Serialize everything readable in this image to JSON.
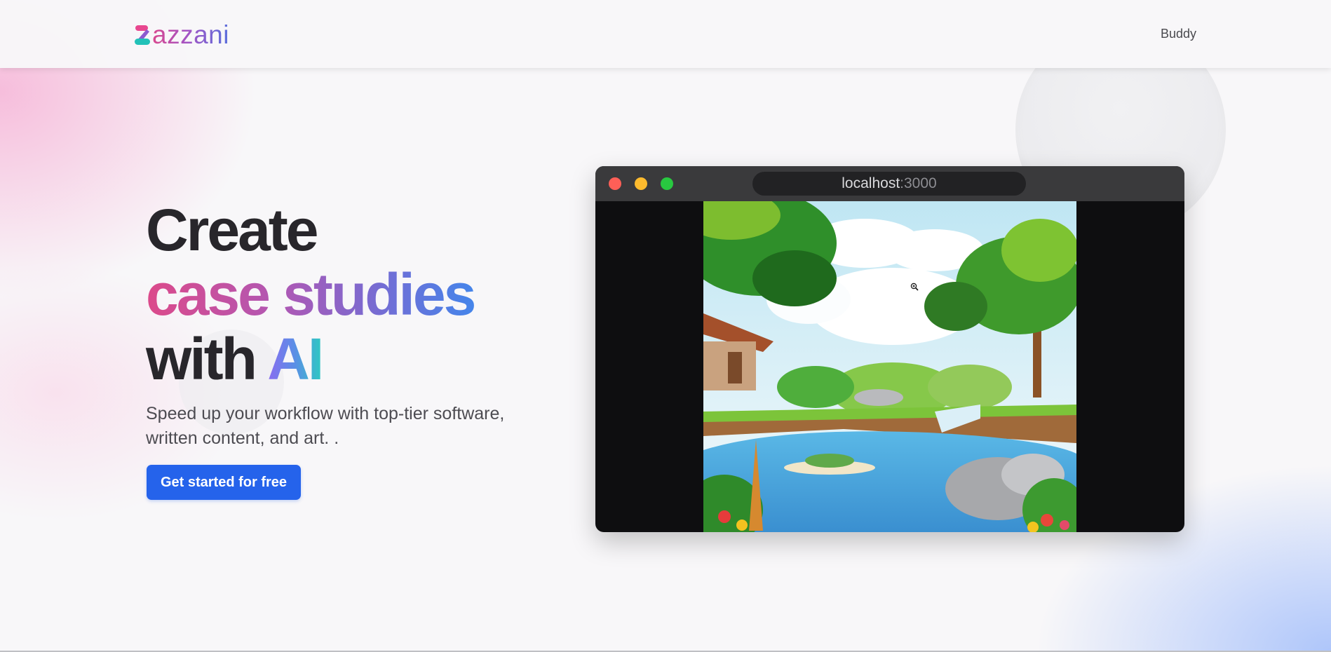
{
  "header": {
    "logo_text": "azzani",
    "logo_icon": "z-logo-icon",
    "nav_link": "Buddy"
  },
  "hero": {
    "title_line1": "Create",
    "title_line2": "case studies",
    "title_line3_plain": "with ",
    "title_line3_accent": "AI",
    "subtitle_line1": "Speed up your workflow with top-tier software,",
    "subtitle_line2": "written content, and art. .",
    "cta_label": "Get started for free"
  },
  "window": {
    "url_host": "localhost",
    "url_port": ":3000",
    "traffic_lights": [
      "close",
      "minimize",
      "maximize"
    ],
    "image_description_icon": "jungle-pond-illustration"
  },
  "colors": {
    "cta": "#2563eb",
    "brand_pink": "#dc4a8a",
    "brand_blue": "#4585ea",
    "accent_teal": "#2ec9c2"
  }
}
